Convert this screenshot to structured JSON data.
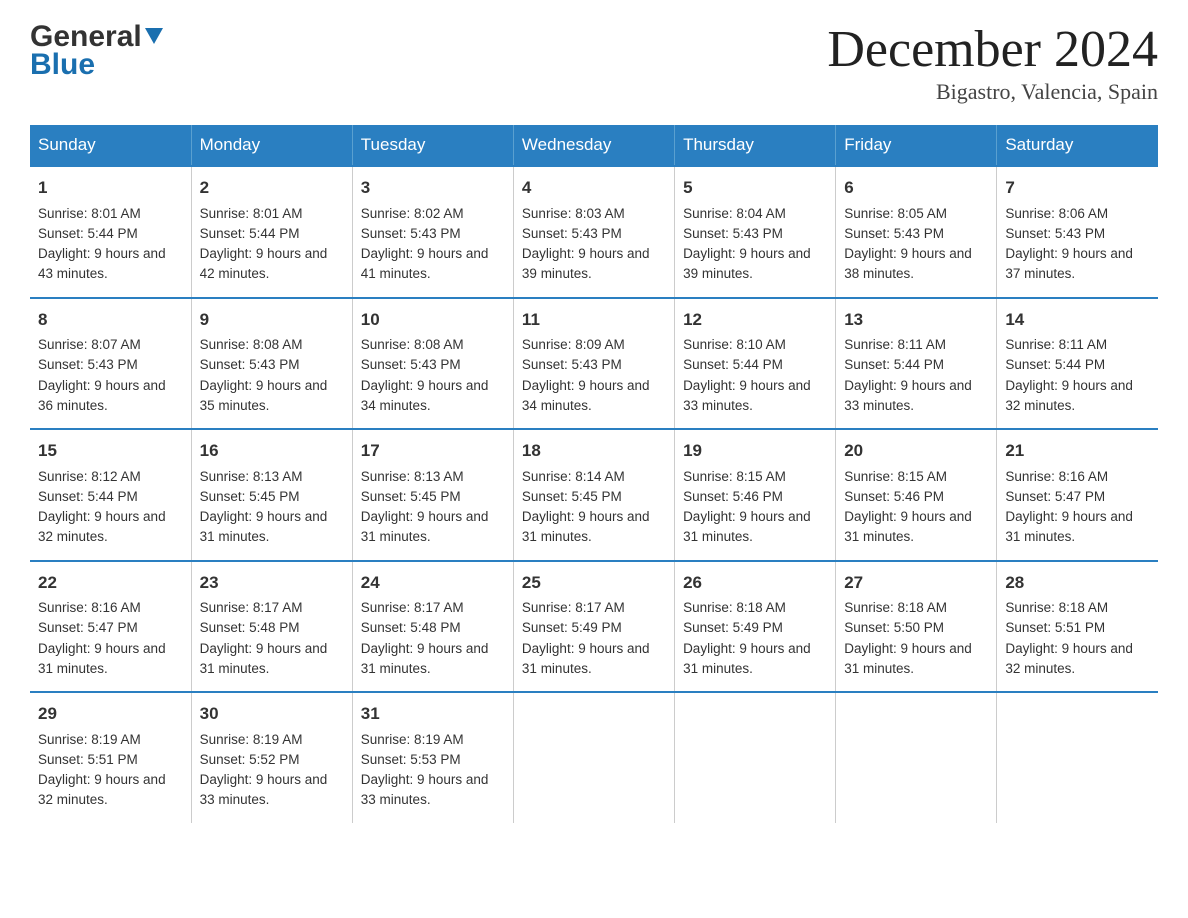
{
  "header": {
    "logo_general": "General",
    "logo_blue": "Blue",
    "month_title": "December 2024",
    "location": "Bigastro, Valencia, Spain"
  },
  "days_of_week": [
    "Sunday",
    "Monday",
    "Tuesday",
    "Wednesday",
    "Thursday",
    "Friday",
    "Saturday"
  ],
  "weeks": [
    [
      {
        "num": "1",
        "sunrise": "8:01 AM",
        "sunset": "5:44 PM",
        "daylight": "9 hours and 43 minutes."
      },
      {
        "num": "2",
        "sunrise": "8:01 AM",
        "sunset": "5:44 PM",
        "daylight": "9 hours and 42 minutes."
      },
      {
        "num": "3",
        "sunrise": "8:02 AM",
        "sunset": "5:43 PM",
        "daylight": "9 hours and 41 minutes."
      },
      {
        "num": "4",
        "sunrise": "8:03 AM",
        "sunset": "5:43 PM",
        "daylight": "9 hours and 39 minutes."
      },
      {
        "num": "5",
        "sunrise": "8:04 AM",
        "sunset": "5:43 PM",
        "daylight": "9 hours and 39 minutes."
      },
      {
        "num": "6",
        "sunrise": "8:05 AM",
        "sunset": "5:43 PM",
        "daylight": "9 hours and 38 minutes."
      },
      {
        "num": "7",
        "sunrise": "8:06 AM",
        "sunset": "5:43 PM",
        "daylight": "9 hours and 37 minutes."
      }
    ],
    [
      {
        "num": "8",
        "sunrise": "8:07 AM",
        "sunset": "5:43 PM",
        "daylight": "9 hours and 36 minutes."
      },
      {
        "num": "9",
        "sunrise": "8:08 AM",
        "sunset": "5:43 PM",
        "daylight": "9 hours and 35 minutes."
      },
      {
        "num": "10",
        "sunrise": "8:08 AM",
        "sunset": "5:43 PM",
        "daylight": "9 hours and 34 minutes."
      },
      {
        "num": "11",
        "sunrise": "8:09 AM",
        "sunset": "5:43 PM",
        "daylight": "9 hours and 34 minutes."
      },
      {
        "num": "12",
        "sunrise": "8:10 AM",
        "sunset": "5:44 PM",
        "daylight": "9 hours and 33 minutes."
      },
      {
        "num": "13",
        "sunrise": "8:11 AM",
        "sunset": "5:44 PM",
        "daylight": "9 hours and 33 minutes."
      },
      {
        "num": "14",
        "sunrise": "8:11 AM",
        "sunset": "5:44 PM",
        "daylight": "9 hours and 32 minutes."
      }
    ],
    [
      {
        "num": "15",
        "sunrise": "8:12 AM",
        "sunset": "5:44 PM",
        "daylight": "9 hours and 32 minutes."
      },
      {
        "num": "16",
        "sunrise": "8:13 AM",
        "sunset": "5:45 PM",
        "daylight": "9 hours and 31 minutes."
      },
      {
        "num": "17",
        "sunrise": "8:13 AM",
        "sunset": "5:45 PM",
        "daylight": "9 hours and 31 minutes."
      },
      {
        "num": "18",
        "sunrise": "8:14 AM",
        "sunset": "5:45 PM",
        "daylight": "9 hours and 31 minutes."
      },
      {
        "num": "19",
        "sunrise": "8:15 AM",
        "sunset": "5:46 PM",
        "daylight": "9 hours and 31 minutes."
      },
      {
        "num": "20",
        "sunrise": "8:15 AM",
        "sunset": "5:46 PM",
        "daylight": "9 hours and 31 minutes."
      },
      {
        "num": "21",
        "sunrise": "8:16 AM",
        "sunset": "5:47 PM",
        "daylight": "9 hours and 31 minutes."
      }
    ],
    [
      {
        "num": "22",
        "sunrise": "8:16 AM",
        "sunset": "5:47 PM",
        "daylight": "9 hours and 31 minutes."
      },
      {
        "num": "23",
        "sunrise": "8:17 AM",
        "sunset": "5:48 PM",
        "daylight": "9 hours and 31 minutes."
      },
      {
        "num": "24",
        "sunrise": "8:17 AM",
        "sunset": "5:48 PM",
        "daylight": "9 hours and 31 minutes."
      },
      {
        "num": "25",
        "sunrise": "8:17 AM",
        "sunset": "5:49 PM",
        "daylight": "9 hours and 31 minutes."
      },
      {
        "num": "26",
        "sunrise": "8:18 AM",
        "sunset": "5:49 PM",
        "daylight": "9 hours and 31 minutes."
      },
      {
        "num": "27",
        "sunrise": "8:18 AM",
        "sunset": "5:50 PM",
        "daylight": "9 hours and 31 minutes."
      },
      {
        "num": "28",
        "sunrise": "8:18 AM",
        "sunset": "5:51 PM",
        "daylight": "9 hours and 32 minutes."
      }
    ],
    [
      {
        "num": "29",
        "sunrise": "8:19 AM",
        "sunset": "5:51 PM",
        "daylight": "9 hours and 32 minutes."
      },
      {
        "num": "30",
        "sunrise": "8:19 AM",
        "sunset": "5:52 PM",
        "daylight": "9 hours and 33 minutes."
      },
      {
        "num": "31",
        "sunrise": "8:19 AM",
        "sunset": "5:53 PM",
        "daylight": "9 hours and 33 minutes."
      },
      {
        "num": "",
        "sunrise": "",
        "sunset": "",
        "daylight": ""
      },
      {
        "num": "",
        "sunrise": "",
        "sunset": "",
        "daylight": ""
      },
      {
        "num": "",
        "sunrise": "",
        "sunset": "",
        "daylight": ""
      },
      {
        "num": "",
        "sunrise": "",
        "sunset": "",
        "daylight": ""
      }
    ]
  ]
}
